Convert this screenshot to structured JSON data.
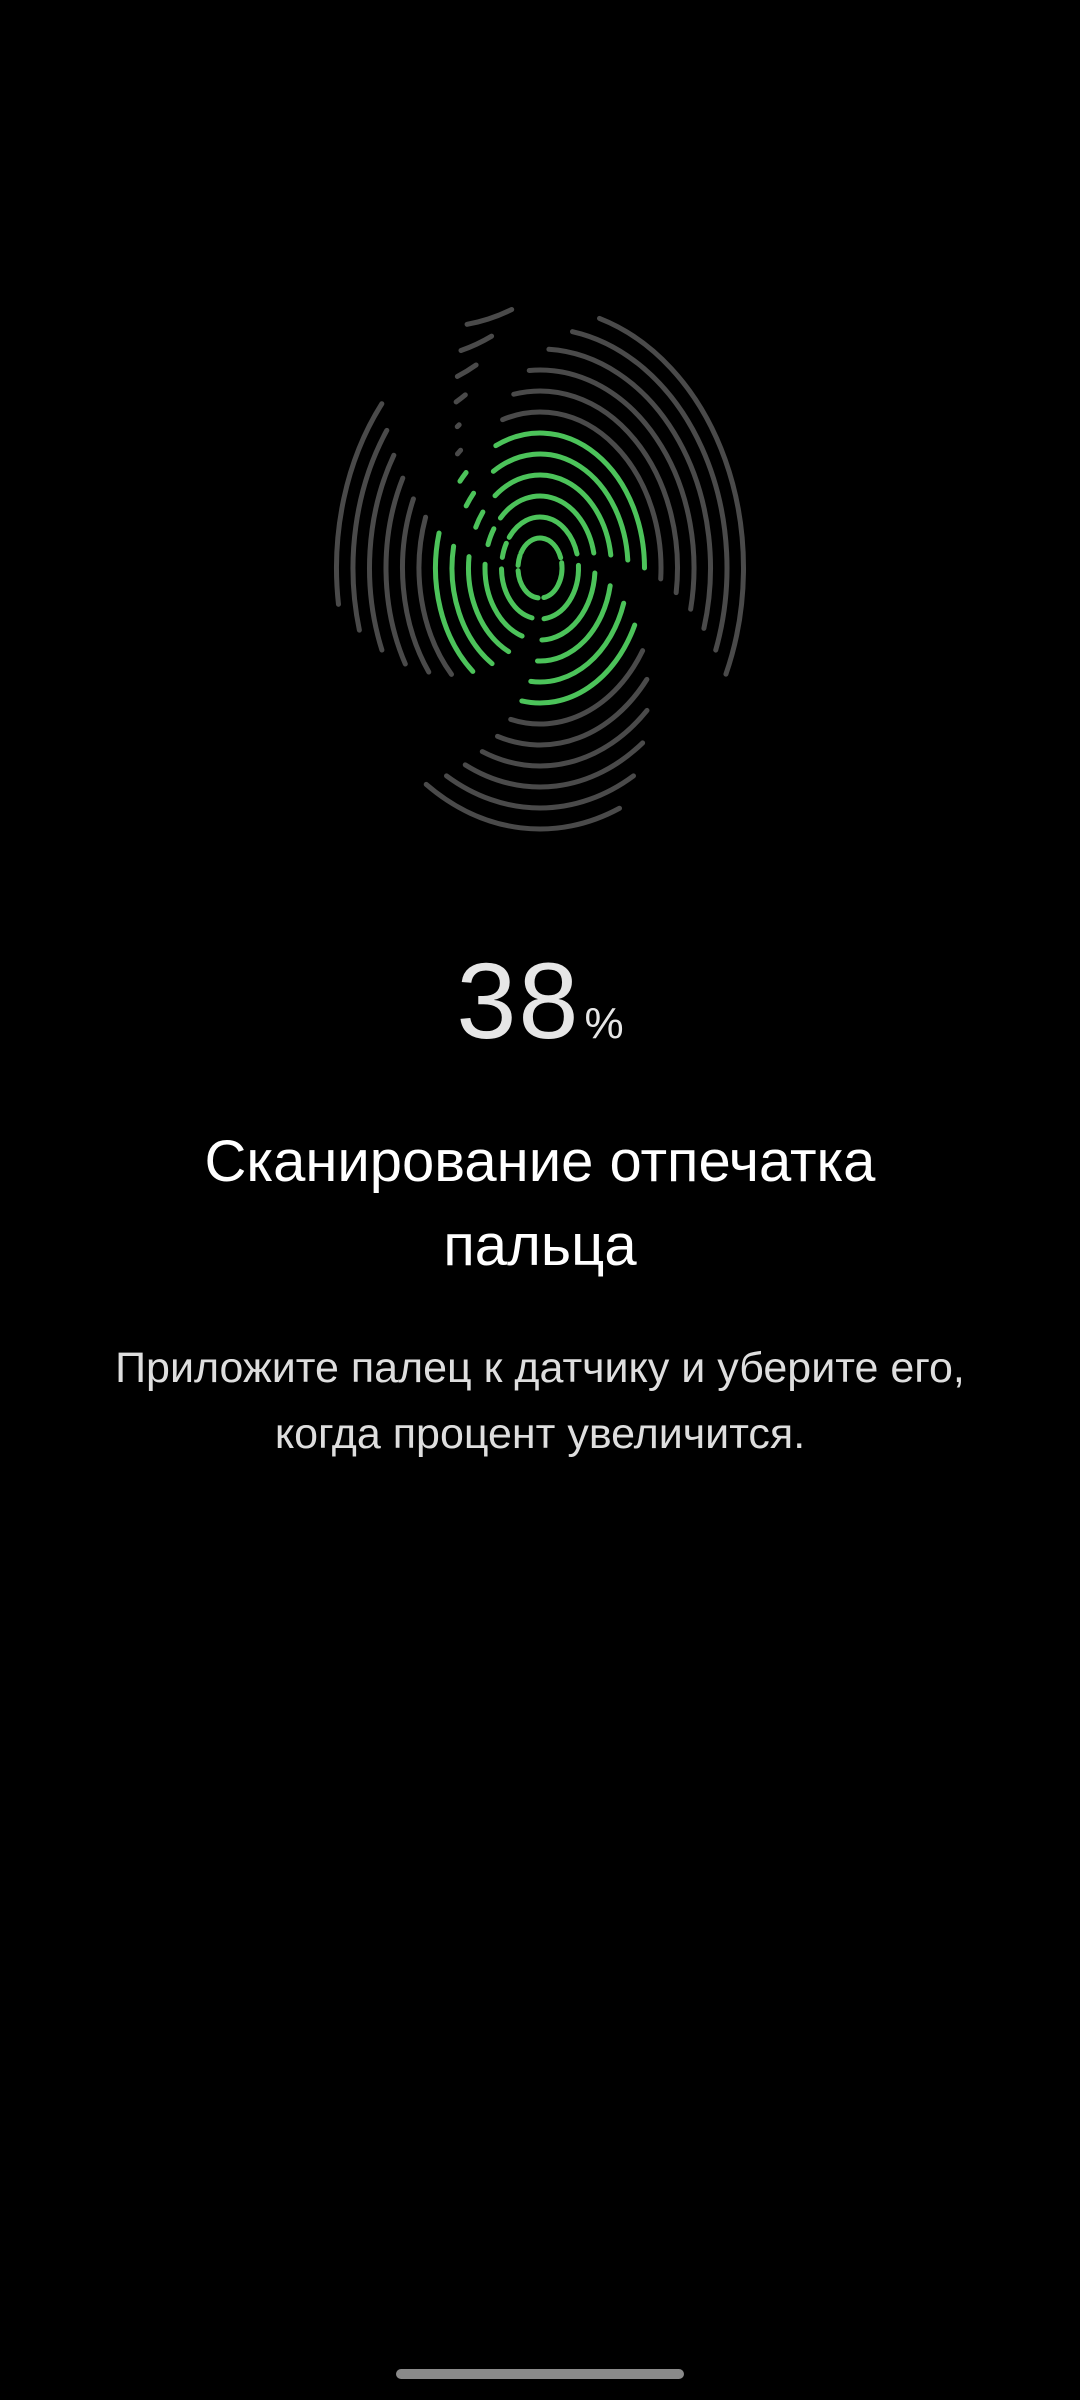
{
  "enrollment": {
    "progress_value": "38",
    "progress_unit": "%",
    "progress_fraction": 0.38,
    "title": "Сканирование отпечатка пальца",
    "instruction": "Приложите палец к датчику и уберите его, когда процент увеличится."
  },
  "colors": {
    "background": "#000000",
    "ridge_inactive": "#4a4a4a",
    "ridge_active": "#4cc35a",
    "text_primary": "#ffffff",
    "text_secondary": "#dedede"
  },
  "icons": {
    "fingerprint": "fingerprint-icon"
  }
}
